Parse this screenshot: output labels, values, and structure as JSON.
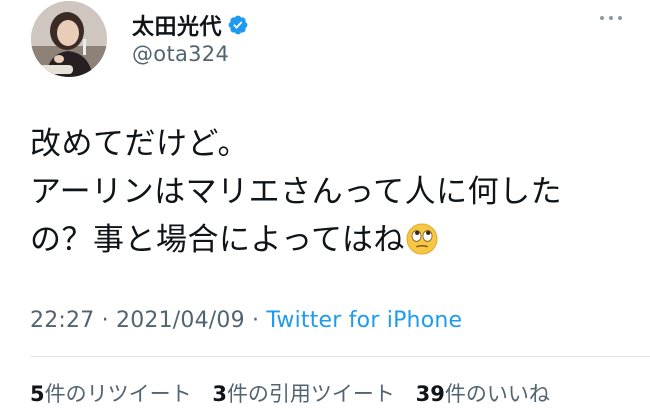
{
  "author": {
    "display_name": "太田光代",
    "handle": "@ota324",
    "verified": true
  },
  "tweet": {
    "lines": [
      "改めてだけど。",
      "アーリンはマリエさんって人に何した",
      "の？事と場合によってはね"
    ],
    "emoji": "face-with-rolling-eyes"
  },
  "meta": {
    "time": "22:27",
    "separator": " · ",
    "date": "2021/04/09",
    "source": "Twitter for iPhone"
  },
  "stats": {
    "retweets_count": "5",
    "retweets_label": "件のリツイート",
    "quotes_count": "3",
    "quotes_label": "件の引用ツイート",
    "likes_count": "39",
    "likes_label": "件のいいね"
  },
  "colors": {
    "accent": "#1d9bf0",
    "muted": "#536471",
    "text": "#0f1419"
  },
  "icons": {
    "verified": "verified-badge-icon",
    "more": "more-options-icon"
  }
}
